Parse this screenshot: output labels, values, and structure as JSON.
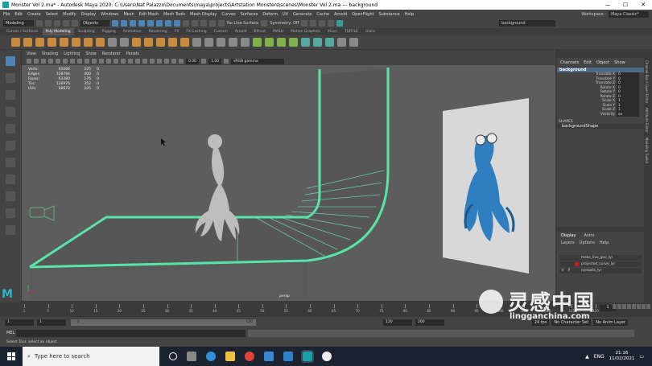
{
  "window": {
    "title": "Monster Vol 2.ma* - Autodesk Maya 2020: C:\\Users\\Nat Palazzo\\Documents\\maya\\projects\\Artstation Monsters\\scenes\\Monster Vol 2.ma  ---  background",
    "minimize": "—",
    "maximize": "☐",
    "close": "✕"
  },
  "menubar": {
    "items": [
      "File",
      "Edit",
      "Create",
      "Select",
      "Modify",
      "Display",
      "Windows",
      "Mesh",
      "Edit Mesh",
      "Mesh Tools",
      "Mesh Display",
      "Curves",
      "Surfaces",
      "Deform",
      "UV",
      "Generate",
      "Cache",
      "Arnold",
      "OpenFlight",
      "Substance",
      "Help"
    ],
    "workspace_label": "Workspace :",
    "workspace_value": "Maya Classic*"
  },
  "statusline": {
    "mode": "Modeling",
    "objects": "Objects",
    "live_surface": "No Live Surface",
    "symmetry": "Symmetry: Off",
    "search": "background"
  },
  "shelf": {
    "tabs": [
      "Curves / Surfaces",
      "Poly Modeling",
      "Sculpting",
      "Rigging",
      "Animation",
      "Rendering",
      "FX",
      "FX Caching",
      "Custom",
      "Arnold",
      "Bifrost",
      "MASH",
      "Motion Graphics",
      "XGen",
      "TURTLE",
      "Glass"
    ],
    "active": "Poly Modeling"
  },
  "viewport": {
    "menu": [
      "View",
      "Shading",
      "Lighting",
      "Show",
      "Renderer",
      "Panels"
    ],
    "field_a": "0.00",
    "field_b": "1.00",
    "color_space": "sRGB gamma",
    "camera": "persp",
    "hud": [
      {
        "label": "Verts:",
        "a": "65066",
        "b": "225",
        "c": "0"
      },
      {
        "label": "Edges:",
        "a": "128784",
        "b": "400",
        "c": "0"
      },
      {
        "label": "Faces:",
        "a": "63280",
        "b": "176",
        "c": "0"
      },
      {
        "label": "Tris:",
        "a": "126976",
        "b": "352",
        "c": "0"
      },
      {
        "label": "UVs:",
        "a": "68672",
        "b": "225",
        "c": "0"
      }
    ]
  },
  "channelbox": {
    "tabs": [
      "Channels",
      "Edit",
      "Object",
      "Show"
    ],
    "node": "background",
    "attributes": [
      {
        "name": "Translate X",
        "value": "0"
      },
      {
        "name": "Translate Y",
        "value": "0"
      },
      {
        "name": "Translate Z",
        "value": "0"
      },
      {
        "name": "Rotate X",
        "value": "0"
      },
      {
        "name": "Rotate Y",
        "value": "0"
      },
      {
        "name": "Rotate Z",
        "value": "0"
      },
      {
        "name": "Scale X",
        "value": "1"
      },
      {
        "name": "Scale Y",
        "value": "1"
      },
      {
        "name": "Scale Z",
        "value": "1"
      },
      {
        "name": "Visibility",
        "value": "on"
      }
    ],
    "shapes_label": "SHAPES",
    "shape": "backgroundShape",
    "side_tabs": [
      "Channel Box / Layer Editor",
      "Attribute Editor",
      "Modeling Toolkit"
    ]
  },
  "layers": {
    "tabs": [
      "Display",
      "Anim"
    ],
    "menu": [
      "Layers",
      "Options",
      "Help"
    ],
    "items": [
      {
        "vis": "",
        "p": "",
        "name": "make_live_geo_lyr",
        "color": "#3a3a3a"
      },
      {
        "vis": "",
        "p": "",
        "name": "projected_curve_lyr",
        "color": "#d01818"
      },
      {
        "vis": "V",
        "p": "P",
        "name": "eyeballs_lyr",
        "color": "#3a3a3a"
      }
    ]
  },
  "timeslider": {
    "ticks": [
      "1",
      "5",
      "10",
      "15",
      "20",
      "25",
      "30",
      "35",
      "40",
      "45",
      "50",
      "55",
      "60",
      "65",
      "70",
      "75",
      "80",
      "85",
      "90",
      "95",
      "100",
      "105",
      "110",
      "115",
      "120"
    ],
    "current_frame": "1"
  },
  "rangeslider": {
    "start": "1",
    "inner_start": "1",
    "bar_start": "1",
    "bar_end": "120",
    "inner_end": "120",
    "end": "200",
    "fps": "24 fps",
    "char_set": "No Character Set",
    "anim_layer": "No Anim Layer"
  },
  "cmdline": {
    "mel": "MEL"
  },
  "helpline": {
    "text": "Select Tool: select an object"
  },
  "taskbar": {
    "search_placeholder": "Type here to search",
    "lang": "ENG",
    "time": "21:16",
    "date": "11/02/2021"
  },
  "watermark": {
    "cn": "灵感中国",
    "url": "lingganchina.com"
  },
  "colors": {
    "viewport_bg": "#5d5d5d",
    "highlight_green": "#58e4a8",
    "accent_blue": "#4d84b8",
    "maya_teal": "#2ab7c8"
  }
}
